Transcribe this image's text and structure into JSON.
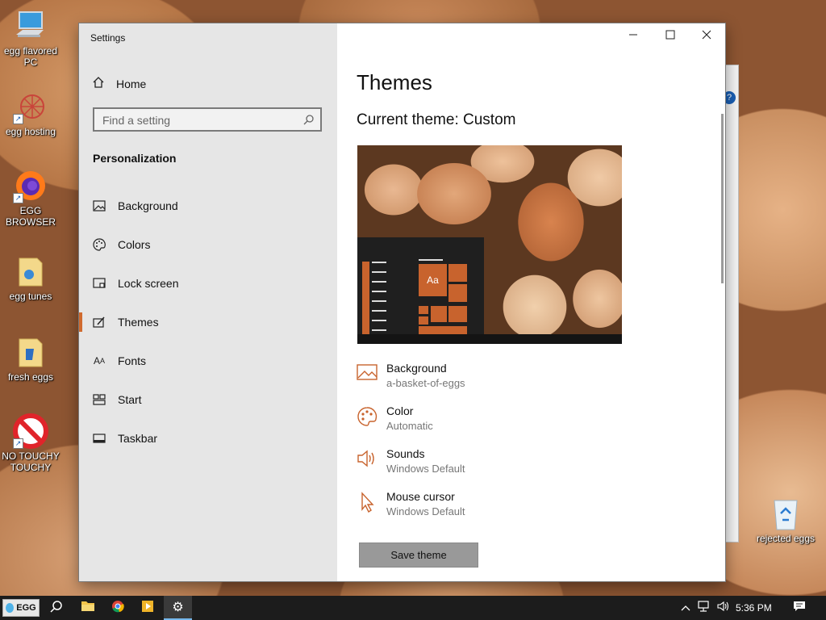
{
  "desktop": {
    "icons": [
      {
        "label": "egg flavored PC",
        "icon": "computer-icon"
      },
      {
        "label": "egg hosting",
        "icon": "web-host-icon"
      },
      {
        "label": "EGG BROWSER",
        "icon": "firefox-icon"
      },
      {
        "label": "egg tunes",
        "icon": "music-folder-icon"
      },
      {
        "label": "fresh eggs",
        "icon": "folder-icon"
      },
      {
        "label": "NO TOUCHY TOUCHY",
        "icon": "no-entry-icon"
      },
      {
        "label": "rejected eggs",
        "icon": "recycle-bin-icon"
      }
    ]
  },
  "window": {
    "title": "Settings",
    "controls": {
      "minimize": "minimize-icon",
      "maximize": "maximize-icon",
      "close": "close-icon"
    }
  },
  "sidebar": {
    "home_label": "Home",
    "search_placeholder": "Find a setting",
    "section_title": "Personalization",
    "items": [
      {
        "label": "Background",
        "icon": "image-icon"
      },
      {
        "label": "Colors",
        "icon": "palette-icon"
      },
      {
        "label": "Lock screen",
        "icon": "lock-screen-icon"
      },
      {
        "label": "Themes",
        "icon": "themes-icon",
        "active": true
      },
      {
        "label": "Fonts",
        "icon": "fonts-icon"
      },
      {
        "label": "Start",
        "icon": "start-icon"
      },
      {
        "label": "Taskbar",
        "icon": "taskbar-icon"
      }
    ]
  },
  "main": {
    "title": "Themes",
    "current_theme_label": "Current theme:",
    "current_theme_value": "Custom",
    "preview_sample_text": "Aa",
    "properties": [
      {
        "title": "Background",
        "value": "a-basket-of-eggs",
        "icon": "image-icon"
      },
      {
        "title": "Color",
        "value": "Automatic",
        "icon": "palette-icon"
      },
      {
        "title": "Sounds",
        "value": "Windows Default",
        "icon": "speaker-icon"
      },
      {
        "title": "Mouse cursor",
        "value": "Windows Default",
        "icon": "cursor-icon"
      }
    ],
    "save_button": "Save theme"
  },
  "taskbar": {
    "start_label": "EGG",
    "clock": "5:36 PM",
    "accent_color": "#76b9ed"
  },
  "colors": {
    "accent": "#d06a2e",
    "sidebar_bg": "#e6e6e6",
    "taskbar_bg": "#1c1c1c"
  }
}
